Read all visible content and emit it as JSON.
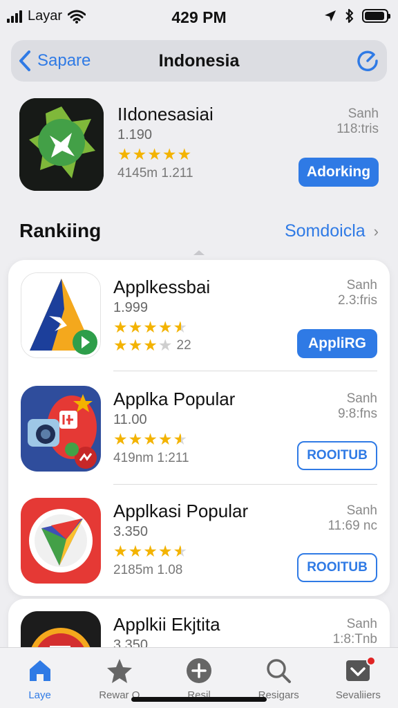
{
  "status_bar": {
    "carrier": "Layar",
    "time": "429 PM"
  },
  "nav": {
    "back_label": "Sapare",
    "title": "Indonesia"
  },
  "featured": {
    "name": "IIdonesasiai",
    "version": "1.190",
    "rating": 5,
    "meta": "4145m 1.211",
    "right_label": "Sanh",
    "right_sub": "118:tris",
    "button_label": "Adorking"
  },
  "section": {
    "title": "Rankiing",
    "link_label": "Somdoicla"
  },
  "apps": [
    {
      "name": "Applkessbai",
      "version": "1.999",
      "rating": 4.5,
      "rating2": 3,
      "meta": "22",
      "right_label": "Sanh",
      "right_sub": "2.3:fris",
      "button_label": "AppliRG",
      "button_style": "filled"
    },
    {
      "name": "Applkа Popular",
      "version": "11.00",
      "rating": 4.5,
      "meta": "419nm 1:211",
      "right_label": "Sanh",
      "right_sub": "9:8:fns",
      "button_label": "ROOITUB",
      "button_style": "outline"
    },
    {
      "name": "Applkasi Popular",
      "version": "3.350",
      "rating": 4.5,
      "meta": "2185m 1.08",
      "right_label": "Sanh",
      "right_sub": "11:69 nc",
      "button_label": "ROOITUB",
      "button_style": "outline"
    },
    {
      "name": "Applkii Ekjtita",
      "version": "3.350",
      "right_label": "Sanh",
      "right_sub": "1:8:Tnb"
    }
  ],
  "tabs": [
    {
      "label": "Laye",
      "icon": "home-icon",
      "active": true
    },
    {
      "label": "Rewar O",
      "icon": "star-icon",
      "active": false
    },
    {
      "label": "Resil",
      "icon": "plus-circle-icon",
      "active": false
    },
    {
      "label": "Resigars",
      "icon": "search-icon",
      "active": false
    },
    {
      "label": "Sevaliiers",
      "icon": "inbox-icon",
      "active": false,
      "badge": true
    }
  ],
  "colors": {
    "accent": "#2f7ae5",
    "star": "#f3b300",
    "badge": "#e02424"
  }
}
